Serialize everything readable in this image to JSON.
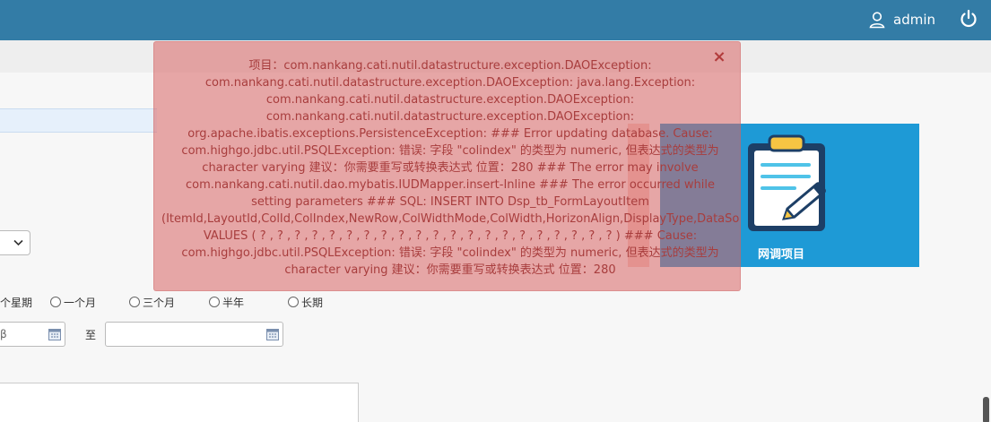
{
  "header": {
    "username": "admin",
    "user_icon": "user-icon",
    "power_icon": "power-icon",
    "color": "#337ca6"
  },
  "form": {
    "period_options": [
      {
        "label": "个星期"
      },
      {
        "label": "一个月"
      },
      {
        "label": "三个月"
      },
      {
        "label": "半年"
      },
      {
        "label": "长期"
      }
    ],
    "date_start_partial": "β",
    "to_label": "至",
    "date_end_value": ""
  },
  "tile": {
    "label": "网调项目",
    "icon": "clipboard-pen-icon",
    "color": "#1e9ad6"
  },
  "toast": {
    "message": "项目：com.nankang.cati.nutil.datastructure.exception.DAOException:\ncom.nankang.cati.nutil.datastructure.exception.DAOException: java.lang.Exception:\ncom.nankang.cati.nutil.datastructure.exception.DAOException:\ncom.nankang.cati.nutil.datastructure.exception.DAOException:\norg.apache.ibatis.exceptions.PersistenceException: ### Error updating database. Cause:\ncom.highgo.jdbc.util.PSQLException: 错误: 字段 \"colindex\" 的类型为 numeric, 但表达式的类型为\ncharacter varying 建议：你需要重写或转换表达式 位置：280 ### The error may involve\ncom.nankang.cati.nutil.dao.mybatis.IUDMapper.insert-Inline ### The error occurred while\nsetting parameters ### SQL: INSERT INTO Dsp_tb_FormLayoutItem\n(ItemId,LayoutId,ColId,ColIndex,NewRow,ColWidthMode,ColWidth,HorizonAlign,DisplayType,DataSourceType,DictId,ReadOnly,Required,Default\nVALUES ( ? , ? , ? , ? , ? , ? , ? , ? , ? , ? , ? , ? , ? , ? , ? , ? , ? , ? , ? , ? , ? ) ### Cause:\ncom.highgo.jdbc.util.PSQLException: 错误: 字段 \"colindex\" 的类型为 numeric, 但表达式的类型为\ncharacter varying 建议：你需要重写或转换表达式 位置：280",
    "close_symbol": "×",
    "color": "#d86464"
  }
}
